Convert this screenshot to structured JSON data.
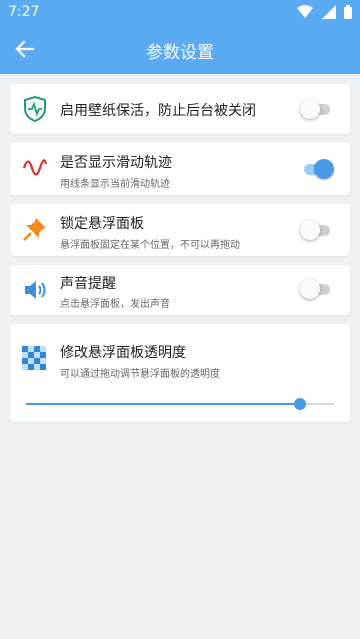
{
  "status_bar": {
    "time": "7:27",
    "icons": [
      "wifi-icon",
      "signal-icon",
      "battery-icon"
    ]
  },
  "header": {
    "title": "参数设置",
    "back_icon": "arrow-left-icon"
  },
  "settings": [
    {
      "id": "wallpaper-keepalive",
      "icon": "shield-heartbeat-icon",
      "title": "启用壁纸保活，防止后台被关闭",
      "subtitle": "",
      "enabled": false
    },
    {
      "id": "show-swipe-track",
      "icon": "sine-wave-icon",
      "title": "是否显示滑动轨迹",
      "subtitle": "用线条显示当前滑动轨迹",
      "enabled": true
    },
    {
      "id": "lock-panel",
      "icon": "pushpin-icon",
      "title": "锁定悬浮面板",
      "subtitle": "悬浮面板固定在某个位置，不可以再拖动",
      "enabled": false
    },
    {
      "id": "sound-alert",
      "icon": "speaker-icon",
      "title": "声音提醒",
      "subtitle": "点击悬浮面板，发出声音",
      "enabled": false
    }
  ],
  "opacity": {
    "icon": "checker-grid-icon",
    "title": "修改悬浮面板透明度",
    "subtitle": "可以通过拖动调节悬浮面板的透明度",
    "value": 0.89
  },
  "colors": {
    "accent": "#4a9ae6",
    "appbar": "#5aaaf4",
    "background": "#eef1f4"
  }
}
